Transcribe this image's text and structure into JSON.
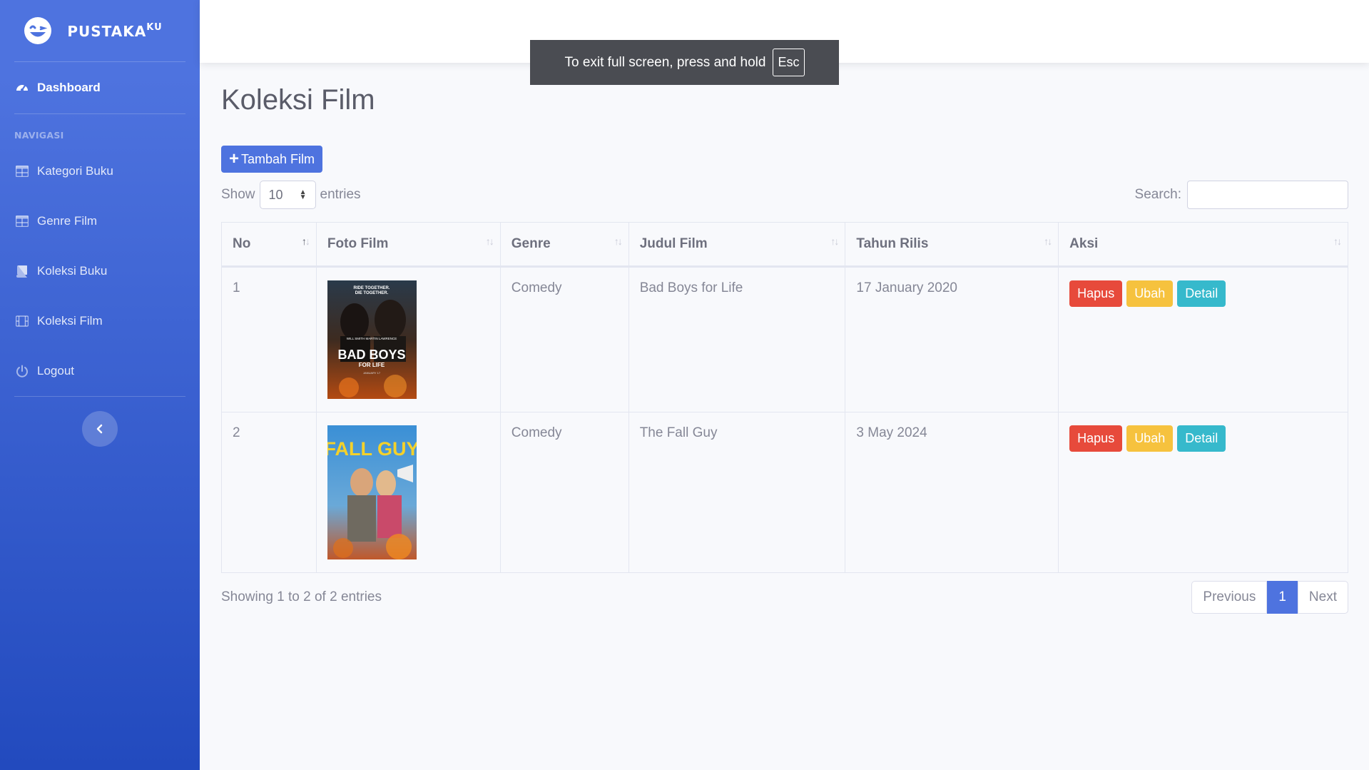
{
  "brand": {
    "name": "PUSTAKA",
    "suffix": "KU"
  },
  "sidebar": {
    "dashboard": "Dashboard",
    "heading": "NAVIGASI",
    "items": [
      {
        "label": "Kategori Buku",
        "icon": "table-icon"
      },
      {
        "label": "Genre Film",
        "icon": "table-icon"
      },
      {
        "label": "Koleksi Buku",
        "icon": "book-icon"
      },
      {
        "label": "Koleksi Film",
        "icon": "film-icon"
      },
      {
        "label": "Logout",
        "icon": "power-icon"
      }
    ]
  },
  "fullscreen_notice": {
    "text": "To exit full screen, press and hold",
    "key": "Esc"
  },
  "page": {
    "title": "Koleksi Film",
    "add_button": "Tambah Film",
    "show_label": "Show",
    "entries_value": "10",
    "entries_label": "entries",
    "search_label": "Search:",
    "search_value": ""
  },
  "table": {
    "headers": [
      "No",
      "Foto Film",
      "Genre",
      "Judul Film",
      "Tahun Rilis",
      "Aksi"
    ],
    "rows": [
      {
        "no": "1",
        "poster": "Bad Boys for Life poster",
        "poster_lines": [
          "RIDE TOGETHER.",
          "DIE TOGETHER.",
          "WILL SMITH   MARTIN LAWRENCE",
          "BAD BOYS",
          "FOR LIFE",
          "JANUARY 17"
        ],
        "genre": "Comedy",
        "title": "Bad Boys for Life",
        "release": "17 January 2020"
      },
      {
        "no": "2",
        "poster": "The Fall Guy poster",
        "poster_lines": [
          "FALL GUY"
        ],
        "genre": "Comedy",
        "title": "The Fall Guy",
        "release": "3 May 2024"
      }
    ],
    "actions": {
      "delete": "Hapus",
      "edit": "Ubah",
      "detail": "Detail"
    }
  },
  "footer": {
    "info": "Showing 1 to 2 of 2 entries",
    "previous": "Previous",
    "current_page": "1",
    "next": "Next"
  },
  "colors": {
    "primary": "#4e73df",
    "danger": "#e74a3b",
    "warning": "#f6c23e",
    "info": "#36b9cc"
  }
}
